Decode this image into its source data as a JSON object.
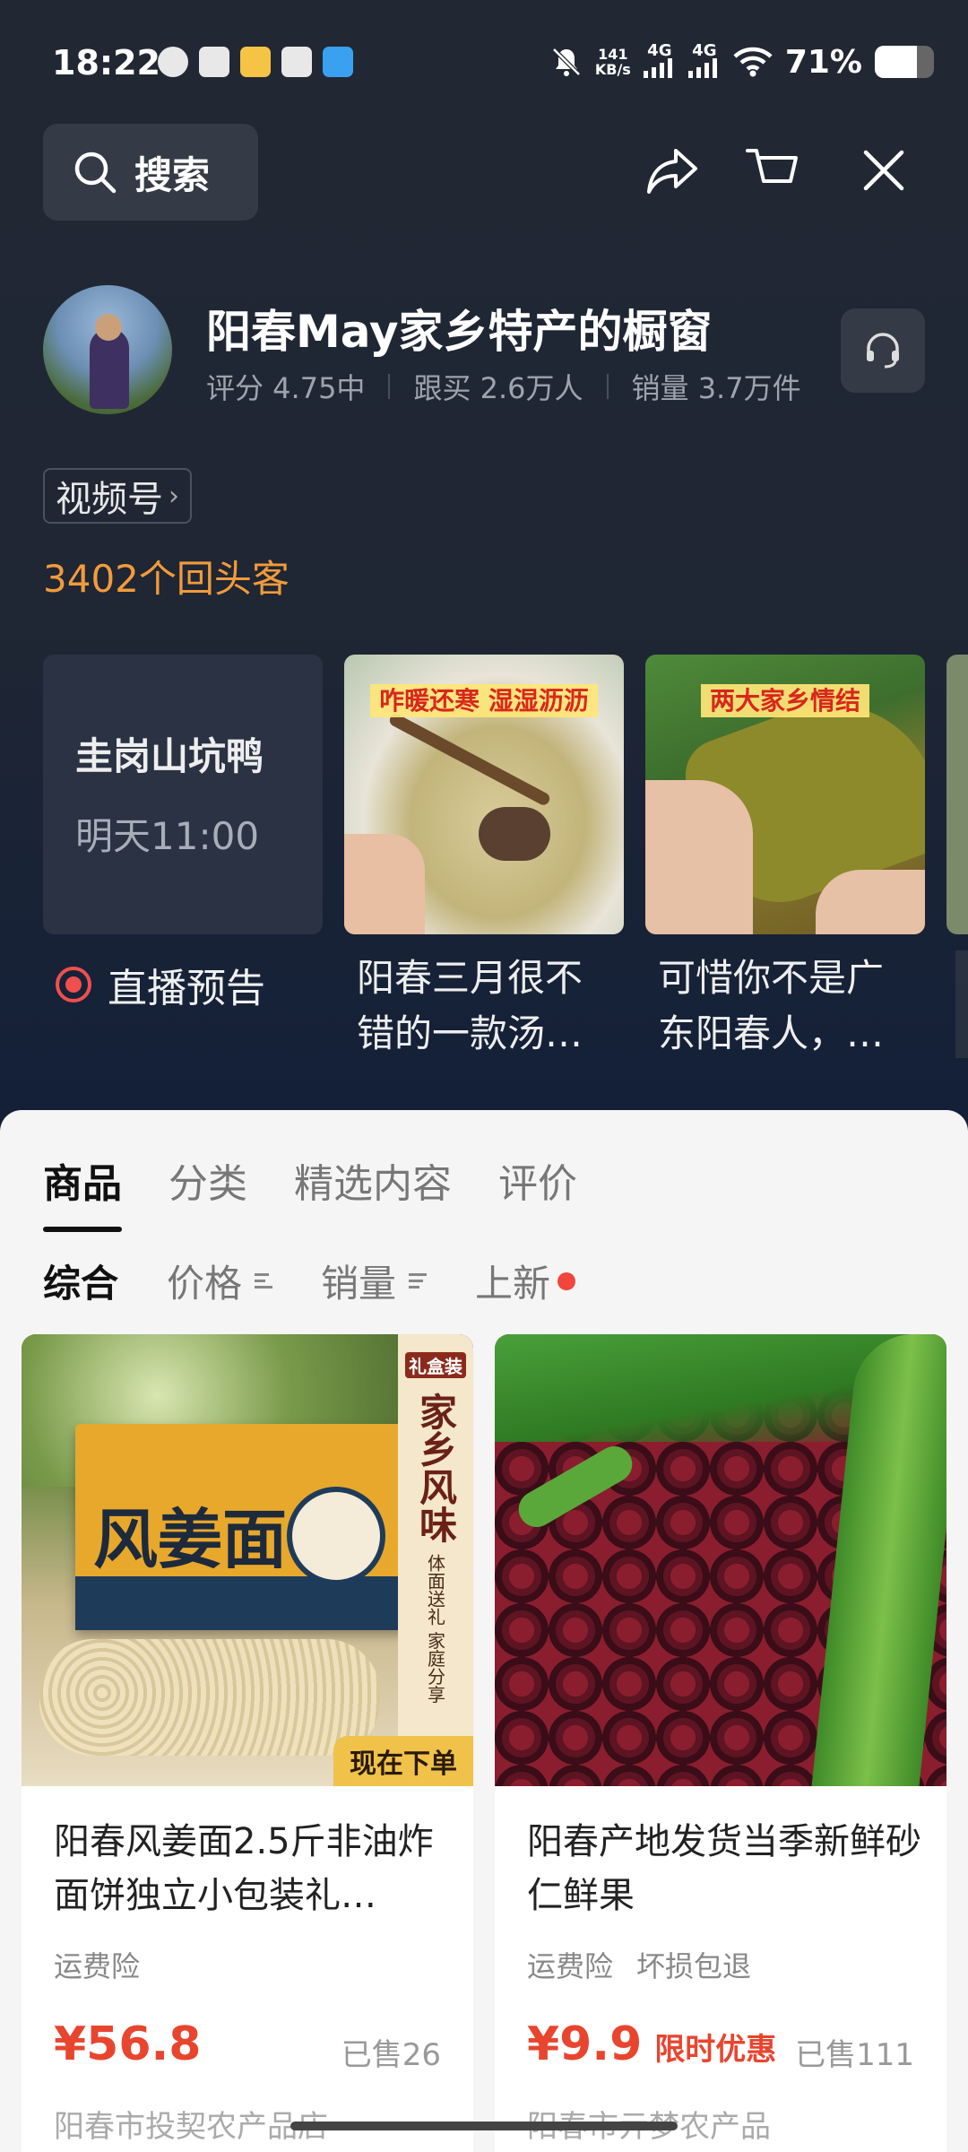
{
  "status": {
    "time": "18:22",
    "net_speed_top": "141",
    "net_speed_unit": "KB/s",
    "signal1": "4G",
    "signal2": "4G",
    "battery_text": "71%",
    "battery_level": 0.71
  },
  "header": {
    "search_label": "搜索"
  },
  "shop": {
    "name": "阳春May家乡特产的橱窗",
    "rating": "评分 4.75中",
    "followers": "跟买 2.6万人",
    "sales": "销量 3.7万件",
    "channel_tag": "视频号",
    "repeat_customers": "3402个回头客"
  },
  "live": {
    "title": "圭岗山坑鸭",
    "time": "明天11:00",
    "label": "直播预告"
  },
  "videos": [
    {
      "banner": "咋暖还寒 湿湿沥沥",
      "title": "阳春三月很不错的一款汤…"
    },
    {
      "banner": "两大家乡情结",
      "title": "可惜你不是广东阳春人，…"
    }
  ],
  "tabs": [
    "商品",
    "分类",
    "精选内容",
    "评价"
  ],
  "sorts": [
    "综合",
    "价格",
    "销量",
    "上新"
  ],
  "products": [
    {
      "title": "阳春风姜面2.5斤非油炸面饼独立小包装礼…",
      "tags": [
        "运费险"
      ],
      "price": "¥56.8",
      "promo": "",
      "sold": "已售26",
      "shop": "阳春市投契农产品店",
      "img_box_text": "风姜面",
      "img_side_text": "家乡风味",
      "img_side_sub": "体面送礼 家庭分享",
      "img_badge": "礼盒装",
      "img_order": "现在下单"
    },
    {
      "title": "阳春产地发货当季新鲜砂仁鲜果",
      "tags": [
        "运费险",
        "坏损包退"
      ],
      "price": "¥9.9",
      "promo": "限时优惠",
      "sold": "已售111",
      "shop": "阳春市亓梦农产品"
    }
  ]
}
